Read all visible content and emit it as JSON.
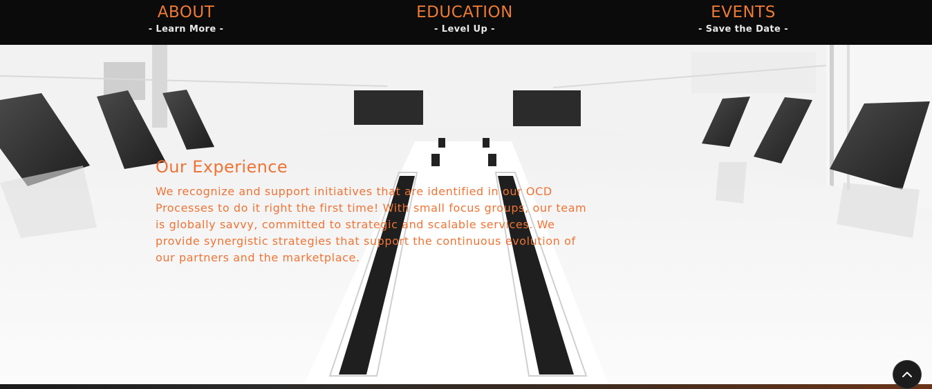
{
  "nav": {
    "items": [
      {
        "title": "ABOUT",
        "subtitle": "- Learn More -"
      },
      {
        "title": "EDUCATION",
        "subtitle": "- Level Up -"
      },
      {
        "title": "EVENTS",
        "subtitle": "- Save the Date -"
      }
    ]
  },
  "hero": {
    "heading": "Our Experience",
    "body": "We recognize and support initiatives that are identified in our OCD Processes to do it right the first time! With small focus groups, our team is globally savvy, committed to strategic and scalable services. We provide synergistic strategies that support the continuous evolution of our partners and the marketplace."
  },
  "scroll_top": {
    "icon": "chevron-up-icon"
  },
  "colors": {
    "accent": "#ef7334",
    "nav_bg": "#0b0b0b",
    "subtitle": "#e8e8e8"
  }
}
